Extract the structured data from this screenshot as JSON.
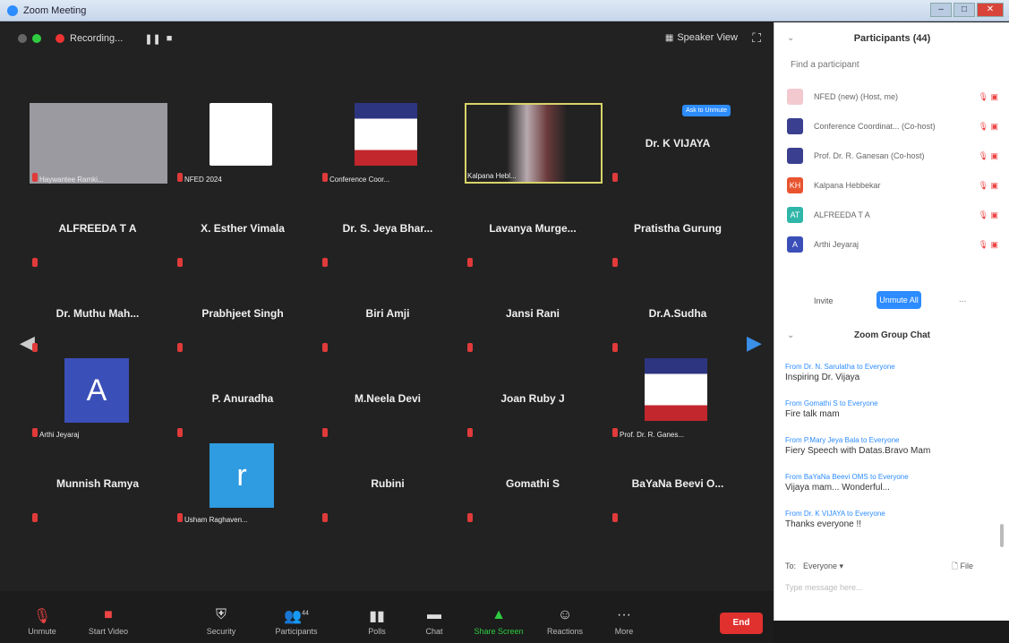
{
  "window": {
    "title": "Zoom Meeting",
    "min": "–",
    "max": "□",
    "close": "✕"
  },
  "topbar": {
    "recording": "Recording...",
    "pause": "❚❚",
    "stop": "■",
    "speaker_view": "Speaker View",
    "fullscreen": "⛶"
  },
  "tiles": [
    [
      "Haywantee Ramki...",
      "NFED 2024",
      "Conference Coor...",
      "Kalpana Hebl...",
      "Dr. K VIJAYA"
    ],
    [
      "ALFREEDA T A",
      "X. Esther Vimala",
      "Dr. S. Jeya Bhar...",
      "Lavanya Murge...",
      "Pratistha Gurung"
    ],
    [
      "Dr. Muthu Mah...",
      "Prabhjeet Singh",
      "Biri Amji",
      "Jansi Rani",
      "Dr.A.Sudha"
    ],
    [
      "Arthi Jeyaraj",
      "P. Anuradha",
      "M.Neela Devi",
      "Joan Ruby J",
      "Prof. Dr. R. Ganes..."
    ],
    [
      "Munnish Ramya",
      "Usham Raghaven...",
      "Rubini",
      "Gomathi S",
      "BaYaNa Beevi O..."
    ]
  ],
  "tile_avatar_letters": {
    "arthi": "A",
    "usham": "r"
  },
  "tile_badge": "Ask to Unmute",
  "toolbar": {
    "unmute": "Unmute",
    "start_video": "Start Video",
    "security": "Security",
    "participants": "Participants",
    "participants_count": "44",
    "polls": "Polls",
    "chat": "Chat",
    "share_screen": "Share Screen",
    "reactions": "Reactions",
    "more": "More",
    "end": "End"
  },
  "participants_panel": {
    "title": "Participants (44)",
    "search_placeholder": "Find a participant",
    "items": [
      {
        "initials": "",
        "name": "NFED (new) (Host, me)",
        "color": "#f2c9cf"
      },
      {
        "initials": "",
        "name": "Conference Coordinat... (Co-host)",
        "color": "#3b3f8f"
      },
      {
        "initials": "",
        "name": "Prof. Dr. R. Ganesan (Co-host)",
        "color": "#3b3f8f"
      },
      {
        "initials": "KH",
        "name": "Kalpana Hebbekar",
        "color": "#e8542f"
      },
      {
        "initials": "AT",
        "name": "ALFREEDA T A",
        "color": "#2fb6a8"
      },
      {
        "initials": "A",
        "name": "Arthi Jeyaraj",
        "color": "#3b4fb8"
      }
    ],
    "invite": "Invite",
    "unmute_all": "Unmute All",
    "more": "..."
  },
  "chat_panel": {
    "title": "Zoom Group Chat",
    "messages": [
      {
        "from": "From Dr. N. Sarulatha to Everyone",
        "text": "Inspiring Dr. Vijaya"
      },
      {
        "from": "From Gomathi S to Everyone",
        "text": "Fire talk mam"
      },
      {
        "from": "From P.Mary Jeya Bala to Everyone",
        "text": "Fiery Speech with Datas.Bravo Mam"
      },
      {
        "from": "From BaYaNa Beevi OMS to Everyone",
        "text": "Vijaya mam... Wonderful..."
      },
      {
        "from": "From Dr. K VIJAYA to Everyone",
        "text": "Thanks everyone !!"
      }
    ],
    "to_label": "To:",
    "to_value": "Everyone ▾",
    "file": "File",
    "placeholder": "Type message here..."
  }
}
